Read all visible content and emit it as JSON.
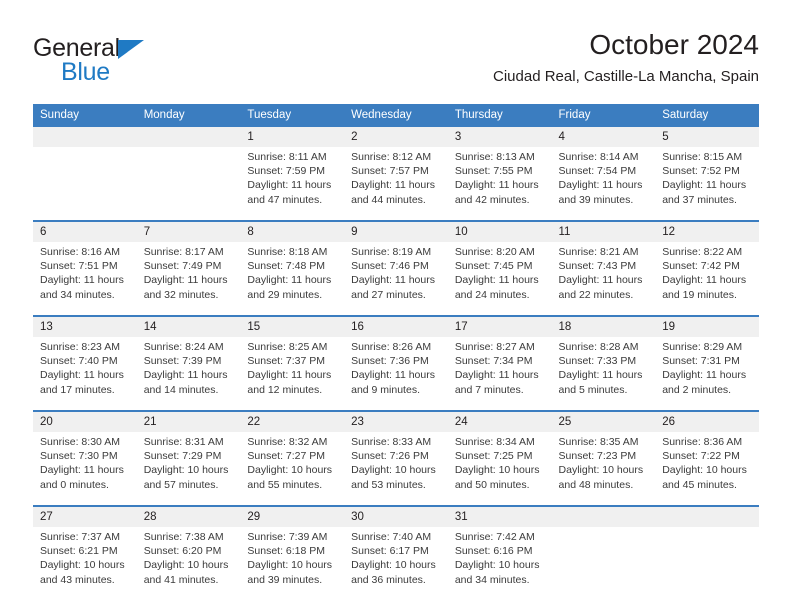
{
  "brand": {
    "name_top": "General",
    "name_bottom": "Blue",
    "triangle_color": "#1f7ac4"
  },
  "header": {
    "title": "October 2024",
    "subtitle": "Ciudad Real, Castille-La Mancha, Spain"
  },
  "theme": {
    "header_blue": "#3b7dc0",
    "daynum_gray": "#f0f0f0",
    "text_dark": "#231f20",
    "text_body": "#3b3b3b"
  },
  "calendar": {
    "weekday_headers": [
      "Sunday",
      "Monday",
      "Tuesday",
      "Wednesday",
      "Thursday",
      "Friday",
      "Saturday"
    ],
    "weeks": [
      [
        {
          "day": "",
          "lines": []
        },
        {
          "day": "",
          "lines": []
        },
        {
          "day": "1",
          "lines": [
            "Sunrise: 8:11 AM",
            "Sunset: 7:59 PM",
            "Daylight: 11 hours",
            "and 47 minutes."
          ]
        },
        {
          "day": "2",
          "lines": [
            "Sunrise: 8:12 AM",
            "Sunset: 7:57 PM",
            "Daylight: 11 hours",
            "and 44 minutes."
          ]
        },
        {
          "day": "3",
          "lines": [
            "Sunrise: 8:13 AM",
            "Sunset: 7:55 PM",
            "Daylight: 11 hours",
            "and 42 minutes."
          ]
        },
        {
          "day": "4",
          "lines": [
            "Sunrise: 8:14 AM",
            "Sunset: 7:54 PM",
            "Daylight: 11 hours",
            "and 39 minutes."
          ]
        },
        {
          "day": "5",
          "lines": [
            "Sunrise: 8:15 AM",
            "Sunset: 7:52 PM",
            "Daylight: 11 hours",
            "and 37 minutes."
          ]
        }
      ],
      [
        {
          "day": "6",
          "lines": [
            "Sunrise: 8:16 AM",
            "Sunset: 7:51 PM",
            "Daylight: 11 hours",
            "and 34 minutes."
          ]
        },
        {
          "day": "7",
          "lines": [
            "Sunrise: 8:17 AM",
            "Sunset: 7:49 PM",
            "Daylight: 11 hours",
            "and 32 minutes."
          ]
        },
        {
          "day": "8",
          "lines": [
            "Sunrise: 8:18 AM",
            "Sunset: 7:48 PM",
            "Daylight: 11 hours",
            "and 29 minutes."
          ]
        },
        {
          "day": "9",
          "lines": [
            "Sunrise: 8:19 AM",
            "Sunset: 7:46 PM",
            "Daylight: 11 hours",
            "and 27 minutes."
          ]
        },
        {
          "day": "10",
          "lines": [
            "Sunrise: 8:20 AM",
            "Sunset: 7:45 PM",
            "Daylight: 11 hours",
            "and 24 minutes."
          ]
        },
        {
          "day": "11",
          "lines": [
            "Sunrise: 8:21 AM",
            "Sunset: 7:43 PM",
            "Daylight: 11 hours",
            "and 22 minutes."
          ]
        },
        {
          "day": "12",
          "lines": [
            "Sunrise: 8:22 AM",
            "Sunset: 7:42 PM",
            "Daylight: 11 hours",
            "and 19 minutes."
          ]
        }
      ],
      [
        {
          "day": "13",
          "lines": [
            "Sunrise: 8:23 AM",
            "Sunset: 7:40 PM",
            "Daylight: 11 hours",
            "and 17 minutes."
          ]
        },
        {
          "day": "14",
          "lines": [
            "Sunrise: 8:24 AM",
            "Sunset: 7:39 PM",
            "Daylight: 11 hours",
            "and 14 minutes."
          ]
        },
        {
          "day": "15",
          "lines": [
            "Sunrise: 8:25 AM",
            "Sunset: 7:37 PM",
            "Daylight: 11 hours",
            "and 12 minutes."
          ]
        },
        {
          "day": "16",
          "lines": [
            "Sunrise: 8:26 AM",
            "Sunset: 7:36 PM",
            "Daylight: 11 hours",
            "and 9 minutes."
          ]
        },
        {
          "day": "17",
          "lines": [
            "Sunrise: 8:27 AM",
            "Sunset: 7:34 PM",
            "Daylight: 11 hours",
            "and 7 minutes."
          ]
        },
        {
          "day": "18",
          "lines": [
            "Sunrise: 8:28 AM",
            "Sunset: 7:33 PM",
            "Daylight: 11 hours",
            "and 5 minutes."
          ]
        },
        {
          "day": "19",
          "lines": [
            "Sunrise: 8:29 AM",
            "Sunset: 7:31 PM",
            "Daylight: 11 hours",
            "and 2 minutes."
          ]
        }
      ],
      [
        {
          "day": "20",
          "lines": [
            "Sunrise: 8:30 AM",
            "Sunset: 7:30 PM",
            "Daylight: 11 hours",
            "and 0 minutes."
          ]
        },
        {
          "day": "21",
          "lines": [
            "Sunrise: 8:31 AM",
            "Sunset: 7:29 PM",
            "Daylight: 10 hours",
            "and 57 minutes."
          ]
        },
        {
          "day": "22",
          "lines": [
            "Sunrise: 8:32 AM",
            "Sunset: 7:27 PM",
            "Daylight: 10 hours",
            "and 55 minutes."
          ]
        },
        {
          "day": "23",
          "lines": [
            "Sunrise: 8:33 AM",
            "Sunset: 7:26 PM",
            "Daylight: 10 hours",
            "and 53 minutes."
          ]
        },
        {
          "day": "24",
          "lines": [
            "Sunrise: 8:34 AM",
            "Sunset: 7:25 PM",
            "Daylight: 10 hours",
            "and 50 minutes."
          ]
        },
        {
          "day": "25",
          "lines": [
            "Sunrise: 8:35 AM",
            "Sunset: 7:23 PM",
            "Daylight: 10 hours",
            "and 48 minutes."
          ]
        },
        {
          "day": "26",
          "lines": [
            "Sunrise: 8:36 AM",
            "Sunset: 7:22 PM",
            "Daylight: 10 hours",
            "and 45 minutes."
          ]
        }
      ],
      [
        {
          "day": "27",
          "lines": [
            "Sunrise: 7:37 AM",
            "Sunset: 6:21 PM",
            "Daylight: 10 hours",
            "and 43 minutes."
          ]
        },
        {
          "day": "28",
          "lines": [
            "Sunrise: 7:38 AM",
            "Sunset: 6:20 PM",
            "Daylight: 10 hours",
            "and 41 minutes."
          ]
        },
        {
          "day": "29",
          "lines": [
            "Sunrise: 7:39 AM",
            "Sunset: 6:18 PM",
            "Daylight: 10 hours",
            "and 39 minutes."
          ]
        },
        {
          "day": "30",
          "lines": [
            "Sunrise: 7:40 AM",
            "Sunset: 6:17 PM",
            "Daylight: 10 hours",
            "and 36 minutes."
          ]
        },
        {
          "day": "31",
          "lines": [
            "Sunrise: 7:42 AM",
            "Sunset: 6:16 PM",
            "Daylight: 10 hours",
            "and 34 minutes."
          ]
        },
        {
          "day": "",
          "lines": []
        },
        {
          "day": "",
          "lines": []
        }
      ]
    ]
  }
}
